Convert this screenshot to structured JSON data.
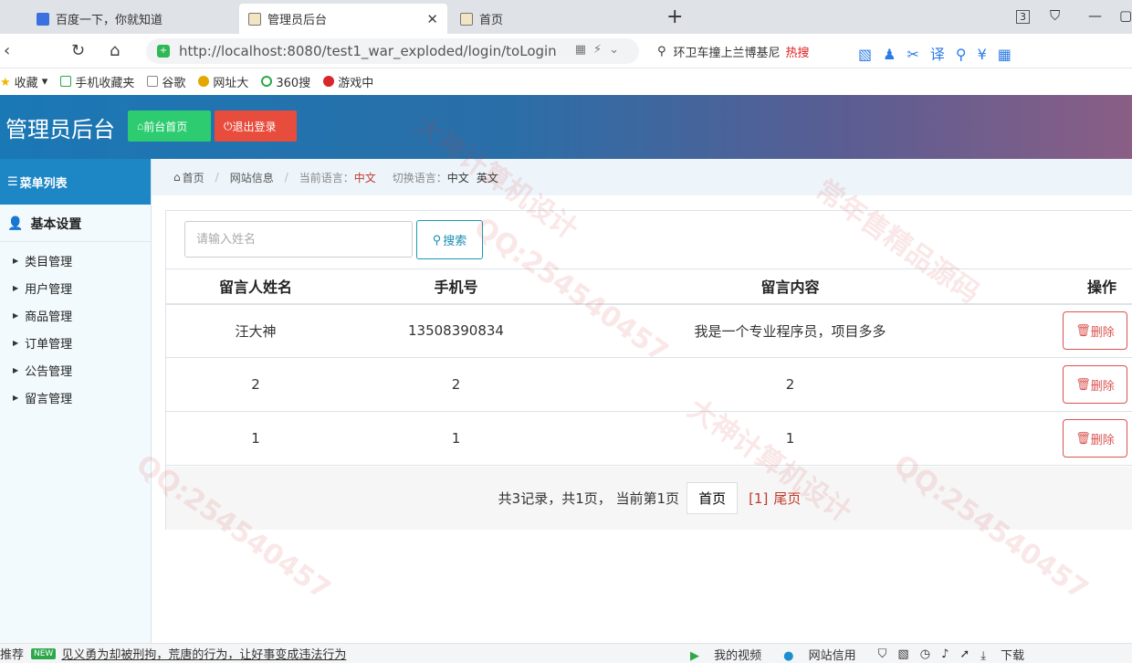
{
  "browser": {
    "tabs": [
      {
        "title": "百度一下，你就知道",
        "active": false
      },
      {
        "title": "管理员后台",
        "active": true
      },
      {
        "title": "首页",
        "active": false
      }
    ],
    "tab_count": "3",
    "url": "http://localhost:8080/test1_war_exploded/login/toLogin",
    "search_suggestion": "环卫车撞上兰博基尼",
    "hot_label": "热搜",
    "bookmarks": [
      "收藏",
      "手机收藏夹",
      "谷歌",
      "网址大",
      "360搜",
      "游戏中"
    ]
  },
  "header": {
    "title": "管理员后台",
    "home_button": "前台首页",
    "logout_button": "退出登录"
  },
  "sidebar": {
    "menu_title": "菜单列表",
    "group_title": "基本设置",
    "items": [
      {
        "label": "类目管理"
      },
      {
        "label": "用户管理"
      },
      {
        "label": "商品管理"
      },
      {
        "label": "订单管理"
      },
      {
        "label": "公告管理"
      },
      {
        "label": "留言管理"
      }
    ]
  },
  "breadcrumb": {
    "home": "首页",
    "section": "网站信息",
    "lang_label": "当前语言：",
    "lang_value": "中文",
    "switch_label": "切换语言：",
    "lang_zh": "中文",
    "lang_en": "英文"
  },
  "search": {
    "placeholder": "请输入姓名",
    "button": "搜索"
  },
  "table": {
    "headers": [
      "留言人姓名",
      "手机号",
      "留言内容",
      "操作"
    ],
    "rows": [
      {
        "name": "汪大神",
        "phone": "13508390834",
        "content": "我是一个专业程序员，项目多多",
        "action": "删除"
      },
      {
        "name": "2",
        "phone": "2",
        "content": "2",
        "action": "删除"
      },
      {
        "name": "1",
        "phone": "1",
        "content": "1",
        "action": "删除"
      }
    ]
  },
  "pagination": {
    "summary": "共3记录，共1页， 当前第1页",
    "first": "首页",
    "current": "[1]",
    "last": "尾页"
  },
  "statusbar": {
    "left_label": "推荐",
    "new_badge": "NEW",
    "news": "见义勇为却被刑拘，荒唐的行为，让好事变成违法行为",
    "video": "我的视频",
    "credit": "网站信用",
    "download": "下载"
  },
  "watermark": {
    "qq": "QQ:254540457",
    "design": "大神计算机设计",
    "source": "常年售精品源码"
  }
}
